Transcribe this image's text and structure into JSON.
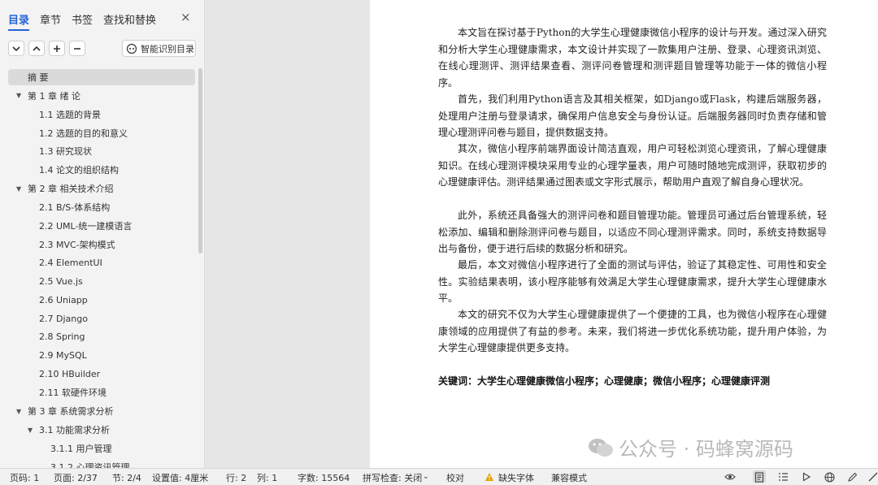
{
  "sidebar": {
    "tabs": [
      "目录",
      "章节",
      "书签",
      "查找和替换"
    ],
    "close": "×",
    "smart_button": "智能识别目录",
    "toc": [
      {
        "label": "摘    要",
        "indent": 0,
        "caret": "",
        "selected": true
      },
      {
        "label": "第 1 章   绪   论",
        "indent": 1,
        "caret": "▼"
      },
      {
        "label": "1.1   选题的背景",
        "indent": 2,
        "caret": ""
      },
      {
        "label": "1.2   选题的目的和意义",
        "indent": 2,
        "caret": ""
      },
      {
        "label": "1.3   研究现状",
        "indent": 2,
        "caret": ""
      },
      {
        "label": "1.4   论文的组织结构",
        "indent": 2,
        "caret": ""
      },
      {
        "label": "第 2 章   相关技术介绍",
        "indent": 1,
        "caret": "▼"
      },
      {
        "label": "2.1   B/S-体系结构",
        "indent": 2,
        "caret": ""
      },
      {
        "label": "2.2   UML-统一建模语言",
        "indent": 2,
        "caret": ""
      },
      {
        "label": "2.3   MVC-架构模式",
        "indent": 2,
        "caret": ""
      },
      {
        "label": "2.4   ElementUI",
        "indent": 2,
        "caret": ""
      },
      {
        "label": "2.5   Vue.js",
        "indent": 2,
        "caret": ""
      },
      {
        "label": "2.6   Uniapp",
        "indent": 2,
        "caret": ""
      },
      {
        "label": "2.7   Django",
        "indent": 2,
        "caret": ""
      },
      {
        "label": "2.8   Spring",
        "indent": 2,
        "caret": ""
      },
      {
        "label": "2.9 MySQL",
        "indent": 2,
        "caret": ""
      },
      {
        "label": "2.10  HBuilder",
        "indent": 2,
        "caret": ""
      },
      {
        "label": "2.11  软硬件环境",
        "indent": 2,
        "caret": ""
      },
      {
        "label": "第 3 章  系统需求分析",
        "indent": 1,
        "caret": "▼"
      },
      {
        "label": "3.1   功能需求分析",
        "indent": 2,
        "caret": "▼"
      },
      {
        "label": "3.1.1   用户管理",
        "indent": 3,
        "caret": ""
      },
      {
        "label": "3.1.2   心理资讯管理",
        "indent": 3,
        "caret": ""
      }
    ]
  },
  "document": {
    "paragraphs": [
      "本文旨在探讨基于Python的大学生心理健康微信小程序的设计与开发。通过深入研究和分析大学生心理健康需求，本文设计并实现了一款集用户注册、登录、心理资讯浏览、在线心理测评、测评结果查看、测评问卷管理和测评题目管理等功能于一体的微信小程序。",
      "首先，我们利用Python语言及其相关框架，如Django或Flask，构建后端服务器，处理用户注册与登录请求，确保用户信息安全与身份认证。后端服务器同时负责存储和管理心理测评问卷与题目，提供数据支持。",
      "其次，微信小程序前端界面设计简洁直观，用户可轻松浏览心理资讯，了解心理健康知识。在线心理测评模块采用专业的心理学量表，用户可随时随地完成测评，获取初步的心理健康评估。测评结果通过图表或文字形式展示，帮助用户直观了解自身心理状况。",
      "此外，系统还具备强大的测评问卷和题目管理功能。管理员可通过后台管理系统，轻松添加、编辑和删除测评问卷与题目，以适应不同心理测评需求。同时，系统支持数据导出与备份，便于进行后续的数据分析和研究。",
      "最后，本文对微信小程序进行了全面的测试与评估，验证了其稳定性、可用性和安全性。实验结果表明，该小程序能够有效满足大学生心理健康需求，提升大学生心理健康水平。",
      "本文的研究不仅为大学生心理健康提供了一个便捷的工具，也为微信小程序在心理健康领域的应用提供了有益的参考。未来，我们将进一步优化系统功能，提升用户体验，为大学生心理健康提供更多支持。"
    ],
    "keywords": "关键词：大学生心理健康微信小程序；心理健康；微信小程序；心理健康评测",
    "watermark": "公众号 · 码蜂窝源码"
  },
  "status": {
    "page_num": "页码: 1",
    "pages": "页面: 2/37",
    "section": "节: 2/4",
    "setting": "设置值: 4厘米",
    "row": "行: 2",
    "col": "列: 1",
    "words": "字数: 15564",
    "spell": "拼写检查: 关闭",
    "proof": "校对",
    "missing_font": "缺失字体",
    "compat": "兼容模式"
  },
  "colors": {
    "accent": "#2463d8",
    "warning": "#e0a100"
  }
}
